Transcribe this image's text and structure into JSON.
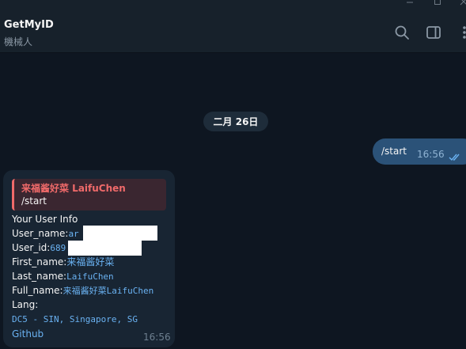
{
  "header": {
    "title": "GetMyID",
    "subtitle": "機械人"
  },
  "chat": {
    "date_label": "二月 26日",
    "outgoing": {
      "text": "/start",
      "time": "16:56"
    },
    "incoming": {
      "reply_name": "来福酱好菜 LaifuChen",
      "reply_text": "/start",
      "heading": "Your User Info",
      "username_label": "User_name:",
      "username_value": "ar",
      "userid_label": "User_id:",
      "userid_value": "689",
      "firstname_label": "First_name:",
      "firstname_value": "来福酱好菜",
      "lastname_label": "Last_name:",
      "lastname_value": "LaifuChen",
      "fullname_label": "Full_name:",
      "fullname_value": "来福酱好菜LaifuChen",
      "lang_label": "Lang:",
      "dc_value": "DC5 - SIN, Singapore, SG",
      "github_link": "Github",
      "time": "16:56"
    }
  },
  "colors": {
    "background": "#0e1621",
    "header": "#17212b",
    "outgoing_bubble": "#2b5278",
    "incoming_bubble": "#182533",
    "link": "#6ab2f2",
    "reply_accent": "#f06a6a"
  },
  "icons": [
    "minimize-icon",
    "maximize-icon",
    "close-icon",
    "search-icon",
    "side-panel-icon",
    "more-icon",
    "double-check-icon"
  ]
}
